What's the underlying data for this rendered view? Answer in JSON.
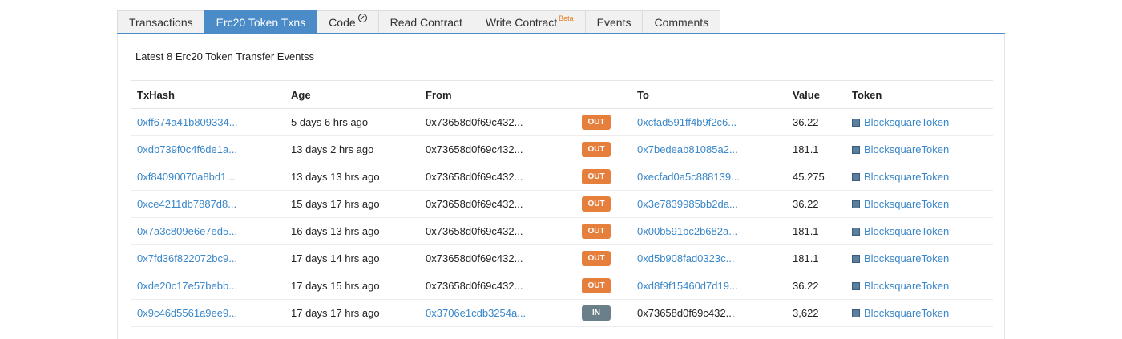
{
  "tabs": [
    {
      "label": "Transactions",
      "active": false
    },
    {
      "label": "Erc20 Token Txns",
      "active": true
    },
    {
      "label": "Code",
      "badge": "check-icon",
      "active": false
    },
    {
      "label": "Read Contract",
      "active": false
    },
    {
      "label": "Write Contract",
      "sup": "Beta",
      "active": false
    },
    {
      "label": "Events",
      "active": false
    },
    {
      "label": "Comments",
      "active": false
    }
  ],
  "caption": "Latest 8 Erc20 Token Transfer Eventss",
  "table": {
    "headers": [
      "TxHash",
      "Age",
      "From",
      "",
      "To",
      "Value",
      "Token"
    ],
    "rows": [
      {
        "txhash": "0xff674a41b809334...",
        "age": "5 days 6 hrs ago",
        "from": "0x73658d0f69c432...",
        "from_link": false,
        "dir": "OUT",
        "to": "0xcfad591ff4b9f2c6...",
        "to_link": true,
        "value": "36.22",
        "token": "BlocksquareToken"
      },
      {
        "txhash": "0xdb739f0c4f6de1a...",
        "age": "13 days 2 hrs ago",
        "from": "0x73658d0f69c432...",
        "from_link": false,
        "dir": "OUT",
        "to": "0x7bedeab81085a2...",
        "to_link": true,
        "value": "181.1",
        "token": "BlocksquareToken"
      },
      {
        "txhash": "0xf84090070a8bd1...",
        "age": "13 days 13 hrs ago",
        "from": "0x73658d0f69c432...",
        "from_link": false,
        "dir": "OUT",
        "to": "0xecfad0a5c888139...",
        "to_link": true,
        "value": "45.275",
        "token": "BlocksquareToken"
      },
      {
        "txhash": "0xce4211db7887d8...",
        "age": "15 days 17 hrs ago",
        "from": "0x73658d0f69c432...",
        "from_link": false,
        "dir": "OUT",
        "to": "0x3e7839985bb2da...",
        "to_link": true,
        "value": "36.22",
        "token": "BlocksquareToken"
      },
      {
        "txhash": "0x7a3c809e6e7ed5...",
        "age": "16 days 13 hrs ago",
        "from": "0x73658d0f69c432...",
        "from_link": false,
        "dir": "OUT",
        "to": "0x00b591bc2b682a...",
        "to_link": true,
        "value": "181.1",
        "token": "BlocksquareToken"
      },
      {
        "txhash": "0x7fd36f822072bc9...",
        "age": "17 days 14 hrs ago",
        "from": "0x73658d0f69c432...",
        "from_link": false,
        "dir": "OUT",
        "to": "0xd5b908fad0323c...",
        "to_link": true,
        "value": "181.1",
        "token": "BlocksquareToken"
      },
      {
        "txhash": "0xde20c17e57bebb...",
        "age": "17 days 15 hrs ago",
        "from": "0x73658d0f69c432...",
        "from_link": false,
        "dir": "OUT",
        "to": "0xd8f9f15460d7d19...",
        "to_link": true,
        "value": "36.22",
        "token": "BlocksquareToken"
      },
      {
        "txhash": "0x9c46d5561a9ee9...",
        "age": "17 days 17 hrs ago",
        "from": "0x3706e1cdb3254a...",
        "from_link": true,
        "dir": "IN",
        "to": "0x73658d0f69c432...",
        "to_link": false,
        "value": "3,622",
        "token": "BlocksquareToken"
      }
    ]
  },
  "colors": {
    "accent": "#4a8bc8",
    "out_badge": "#e67e3c",
    "in_badge": "#6b7f8a",
    "link": "#3a87c9"
  }
}
